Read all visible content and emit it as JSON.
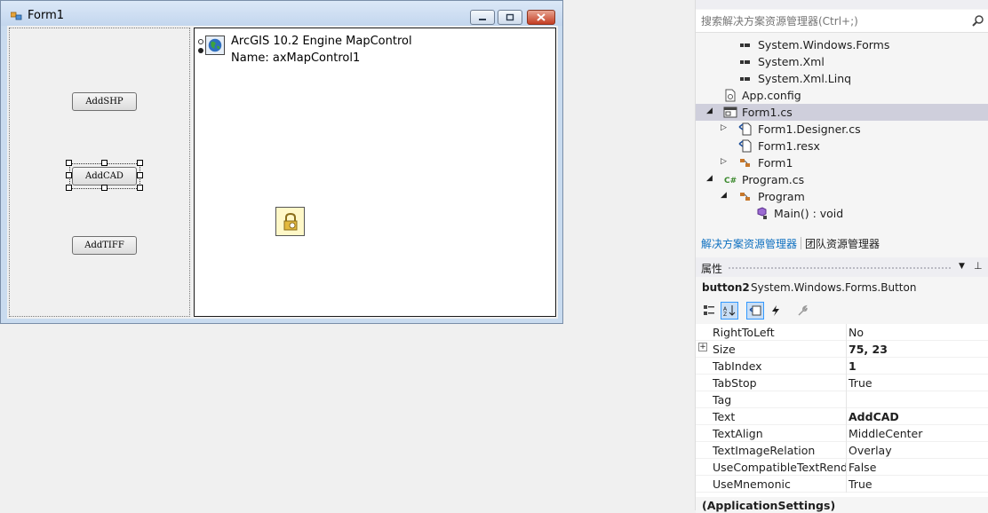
{
  "form": {
    "title": "Form1",
    "buttons": [
      {
        "label": "AddSHP"
      },
      {
        "label": "AddCAD"
      },
      {
        "label": "AddTIFF"
      }
    ],
    "map_control": {
      "line1": "ArcGIS 10.2 Engine MapControl",
      "line2": "Name: axMapControl1"
    }
  },
  "solution_explorer": {
    "search_placeholder": "搜索解决方案资源管理器(Ctrl+;)",
    "tree": [
      {
        "label": "System.Windows.Forms",
        "icon": "reference-icon",
        "arrow": ""
      },
      {
        "label": "System.Xml",
        "icon": "reference-icon",
        "arrow": ""
      },
      {
        "label": "System.Xml.Linq",
        "icon": "reference-icon",
        "arrow": ""
      },
      {
        "label": "App.config",
        "icon": "config-file-icon",
        "arrow": ""
      },
      {
        "label": "Form1.cs",
        "icon": "form-file-icon",
        "arrow": "◢"
      },
      {
        "label": "Form1.Designer.cs",
        "icon": "cs-file-icon",
        "arrow": "▷"
      },
      {
        "label": "Form1.resx",
        "icon": "resx-file-icon",
        "arrow": ""
      },
      {
        "label": "Form1",
        "icon": "class-icon",
        "arrow": "▷"
      },
      {
        "label": "Program.cs",
        "icon": "csharp-file-icon",
        "arrow": "◢"
      },
      {
        "label": "Program",
        "icon": "class-icon",
        "arrow": "◢"
      },
      {
        "label": "Main() : void",
        "icon": "method-icon",
        "arrow": ""
      }
    ],
    "tabs": {
      "solution": "解决方案资源管理器",
      "team": "团队资源管理器"
    }
  },
  "properties": {
    "title": "属性",
    "object_name": "button2",
    "object_type": "System.Windows.Forms.Button",
    "rows": [
      {
        "name": "RightToLeft",
        "value": "No",
        "bold": false,
        "expandable": false
      },
      {
        "name": "Size",
        "value": "75, 23",
        "bold": true,
        "expandable": true
      },
      {
        "name": "TabIndex",
        "value": "1",
        "bold": true,
        "expandable": false
      },
      {
        "name": "TabStop",
        "value": "True",
        "bold": false,
        "expandable": false
      },
      {
        "name": "Tag",
        "value": "",
        "bold": false,
        "expandable": false
      },
      {
        "name": "Text",
        "value": "AddCAD",
        "bold": true,
        "expandable": false
      },
      {
        "name": "TextAlign",
        "value": "MiddleCenter",
        "bold": false,
        "expandable": false
      },
      {
        "name": "TextImageRelation",
        "value": "Overlay",
        "bold": false,
        "expandable": false
      },
      {
        "name": "UseCompatibleTextRende",
        "value": "False",
        "bold": false,
        "expandable": false
      },
      {
        "name": "UseMnemonic",
        "value": "True",
        "bold": false,
        "expandable": false
      }
    ],
    "category": "(ApplicationSettings)"
  },
  "colors": {
    "accent": "#0e70c0",
    "selection": "#cfcfdc",
    "window_frame": "#c9dbef"
  }
}
